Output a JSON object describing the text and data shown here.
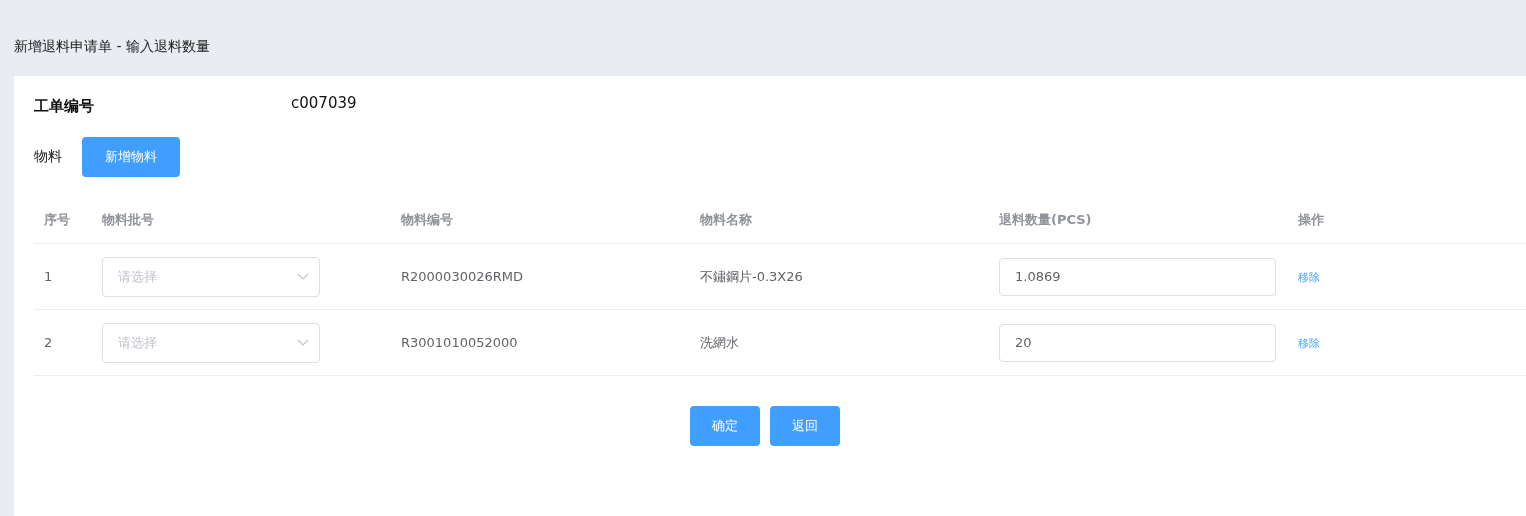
{
  "page_title": "新增退料申请单 - 输入退料数量",
  "work_order": {
    "label": "工单编号",
    "value": "c007039"
  },
  "materials": {
    "label": "物料",
    "add_button": "新增物料"
  },
  "table": {
    "columns": [
      "序号",
      "物料批号",
      "物料编号",
      "物料名称",
      "退料数量(PCS)",
      "操作"
    ],
    "rows": [
      {
        "index": "1",
        "batch_placeholder": "请选择",
        "code": "R2000030026RMD",
        "name": "不鏽鋼片-0.3X26",
        "quantity": "1.0869",
        "action": "移除"
      },
      {
        "index": "2",
        "batch_placeholder": "请选择",
        "code": "R3001010052000",
        "name": "洗網水",
        "quantity": "20",
        "action": "移除"
      }
    ]
  },
  "buttons": [
    "确定",
    "返回"
  ]
}
